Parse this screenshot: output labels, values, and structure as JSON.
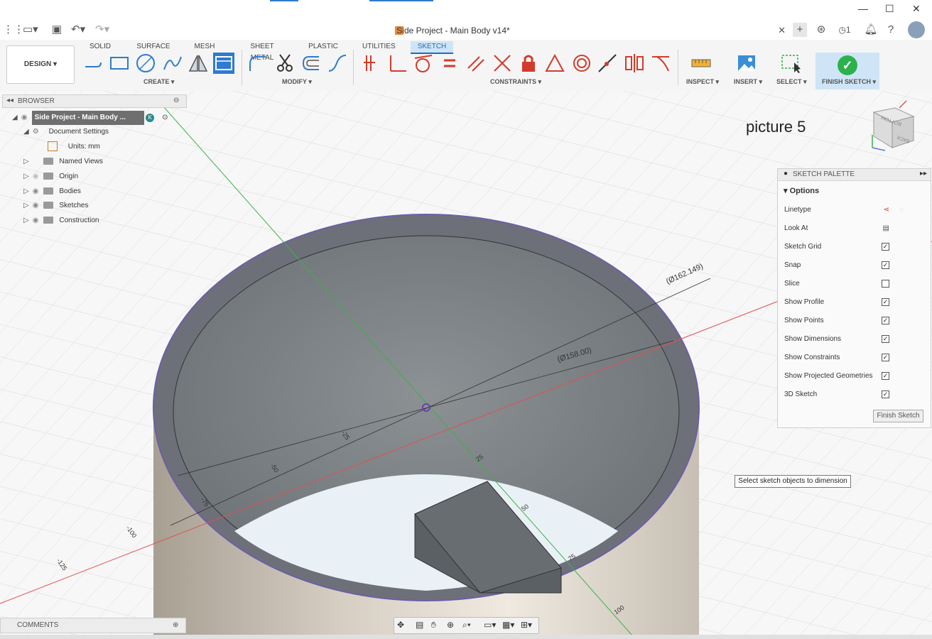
{
  "window": {
    "doc_title": "Side Project - Main Body v14*",
    "notification_count": "1"
  },
  "toolbar": {
    "workspace_button": "DESIGN ▾",
    "tabs": [
      "SOLID",
      "SURFACE",
      "MESH",
      "SHEET METAL",
      "PLASTIC",
      "UTILITIES",
      "SKETCH"
    ],
    "active_tab": "SKETCH",
    "groups": {
      "create": "CREATE ▾",
      "modify": "MODIFY ▾",
      "constraints": "CONSTRAINTS ▾",
      "inspect": "INSPECT ▾",
      "insert": "INSERT ▾",
      "select": "SELECT ▾",
      "finish_sketch": "FINISH SKETCH ▾"
    }
  },
  "browser": {
    "title": "BROWSER",
    "root_label": "Side Project - Main Body ...",
    "items": [
      {
        "label": "Document Settings"
      },
      {
        "label": "Units: mm"
      },
      {
        "label": "Named Views"
      },
      {
        "label": "Origin"
      },
      {
        "label": "Bodies"
      },
      {
        "label": "Sketches"
      },
      {
        "label": "Construction"
      }
    ]
  },
  "viewport": {
    "picture_label": "picture 5",
    "dimension_outer": "(Ø162.149)",
    "dimension_inner": "(Ø158.00)",
    "axis_ticks": [
      "-25",
      "-50",
      "-75",
      "-100",
      "-125",
      "25",
      "50",
      "75",
      "100"
    ],
    "tooltip": "Select sketch objects to dimension",
    "viewcube_labels": [
      "BOTTOM",
      "BACK"
    ]
  },
  "sketch_palette": {
    "title": "SKETCH PALETTE",
    "section": "Options",
    "options": [
      {
        "label": "Linetype",
        "control": "icons"
      },
      {
        "label": "Look At",
        "control": "icon"
      },
      {
        "label": "Sketch Grid",
        "checked": true
      },
      {
        "label": "Snap",
        "checked": true
      },
      {
        "label": "Slice",
        "checked": false
      },
      {
        "label": "Show Profile",
        "checked": true
      },
      {
        "label": "Show Points",
        "checked": true
      },
      {
        "label": "Show Dimensions",
        "checked": true
      },
      {
        "label": "Show Constraints",
        "checked": true
      },
      {
        "label": "Show Projected Geometries",
        "checked": true
      },
      {
        "label": "3D Sketch",
        "checked": true
      }
    ],
    "finish_button": "Finish Sketch"
  },
  "comments": {
    "label": "COMMENTS"
  },
  "colors": {
    "accent": "#1a6fb5",
    "active_tab_bg": "#cfe5f7",
    "tool_blue": "#2e7bcf",
    "constraint_red": "#d23b2b",
    "finish_green": "#2bb24c"
  }
}
